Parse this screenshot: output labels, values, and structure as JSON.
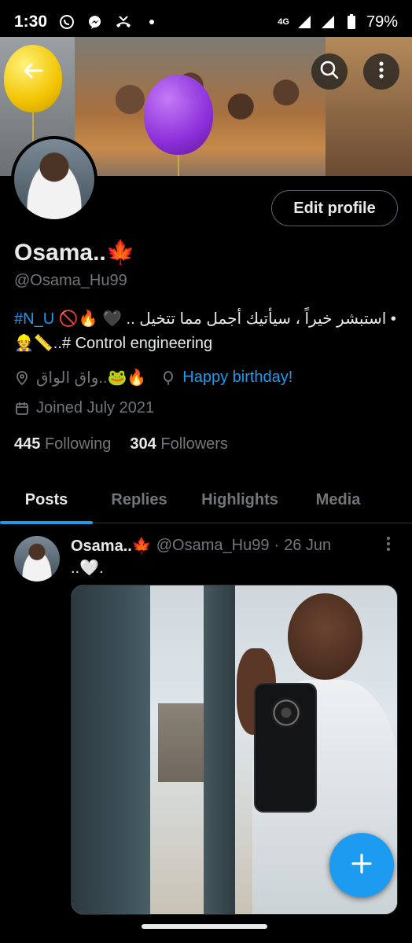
{
  "status_bar": {
    "time": "1:30",
    "network": "4G",
    "battery": "79%",
    "icons": [
      "whatsapp-icon",
      "messenger-icon",
      "missed-call-icon",
      "dot-icon",
      "signal-icon",
      "battery-icon"
    ]
  },
  "header": {
    "back_icon": "arrow-left-icon",
    "search_icon": "search-icon",
    "more_icon": "more-vertical-icon"
  },
  "profile": {
    "edit_label": "Edit profile",
    "name": "Osama..🍁",
    "handle": "@Osama_Hu99",
    "bio_tag": "#N_U",
    "bio_emojis": "🚫🔥",
    "bio_heart": "🖤",
    "bio_arabic": "• استبشر خيراً ، سيأتيك أجمل مما تتخيل ..",
    "bio_line2": "👷📏..# Control engineering",
    "location": "واق الواق..🐸🔥",
    "birthday": "Happy birthday!",
    "joined": "Joined July 2021",
    "following_count": "445",
    "following_label": "Following",
    "followers_count": "304",
    "followers_label": "Followers"
  },
  "tabs": [
    {
      "label": "Posts",
      "active": true
    },
    {
      "label": "Replies",
      "active": false
    },
    {
      "label": "Highlights",
      "active": false
    },
    {
      "label": "Media",
      "active": false
    }
  ],
  "post": {
    "name": "Osama..🍁",
    "handle": "@Osama_Hu99",
    "separator": "·",
    "date": "26 Jun",
    "text": "..🤍."
  },
  "colors": {
    "accent": "#1d9bf0",
    "background": "#000000",
    "muted": "#71767b",
    "text": "#e7e9ea"
  }
}
